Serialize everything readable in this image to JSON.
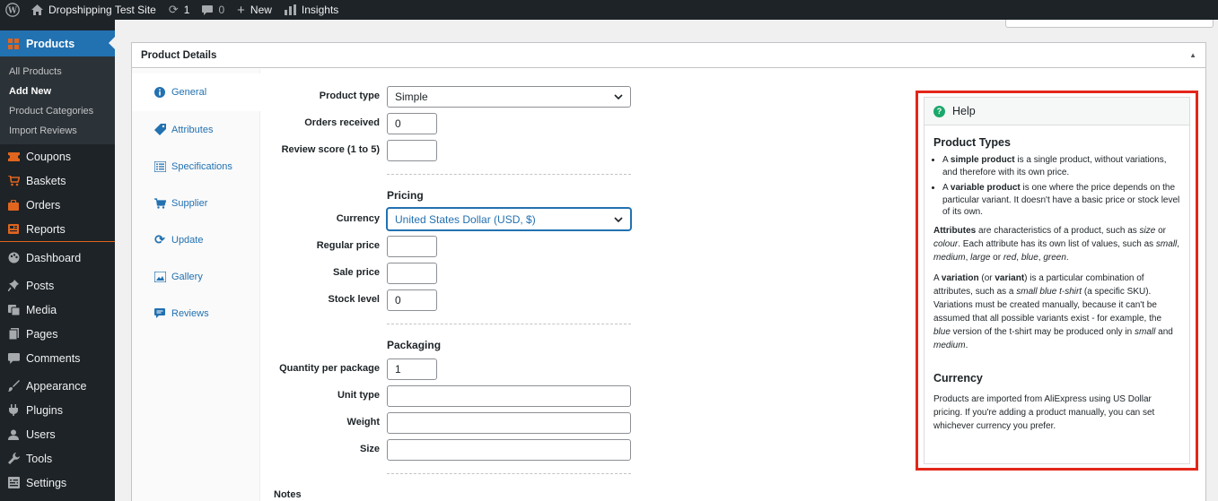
{
  "adminbar": {
    "site_name": "Dropshipping Test Site",
    "updates_count": "1",
    "comments_count": "0",
    "new_label": "New",
    "insights_label": "Insights"
  },
  "sidebar": {
    "products_label": "Products",
    "submenu": [
      "All Products",
      "Add New",
      "Product Categories",
      "Import Reviews"
    ],
    "woo_items": [
      "Coupons",
      "Baskets",
      "Orders",
      "Reports"
    ],
    "dashboard": "Dashboard",
    "items": [
      "Posts",
      "Media",
      "Pages",
      "Comments"
    ],
    "items2": [
      "Appearance",
      "Plugins",
      "Users",
      "Tools",
      "Settings"
    ]
  },
  "postbox": {
    "title": "Product Details"
  },
  "tabs": [
    "General",
    "Attributes",
    "Specifications",
    "Supplier",
    "Update",
    "Gallery",
    "Reviews"
  ],
  "form": {
    "product_type_label": "Product type",
    "product_type_value": "Simple",
    "orders_label": "Orders received",
    "orders_value": "0",
    "review_label": "Review score (1 to 5)",
    "review_value": "",
    "pricing_title": "Pricing",
    "currency_label": "Currency",
    "currency_value": "United States Dollar (USD, $)",
    "regular_price_label": "Regular price",
    "regular_price_value": "",
    "sale_price_label": "Sale price",
    "sale_price_value": "",
    "stock_label": "Stock level",
    "stock_value": "0",
    "packaging_title": "Packaging",
    "qty_label": "Quantity per package",
    "qty_value": "1",
    "unit_label": "Unit type",
    "unit_value": "",
    "weight_label": "Weight",
    "weight_value": "",
    "size_label": "Size",
    "size_value": "",
    "notes_label": "Notes"
  },
  "help": {
    "title": "Help",
    "product_types_heading": "Product Types",
    "currency_heading": "Currency",
    "currency_text": "Products are imported from AliExpress using US Dollar pricing. If you're adding a product manually, you can set whichever currency you prefer.",
    "accent_color": "#e32619"
  },
  "colors": {
    "admin_dark": "#1d2327",
    "wp_blue": "#2271b1",
    "woo_orange": "#e0651e",
    "help_green": "#1ba86b"
  }
}
